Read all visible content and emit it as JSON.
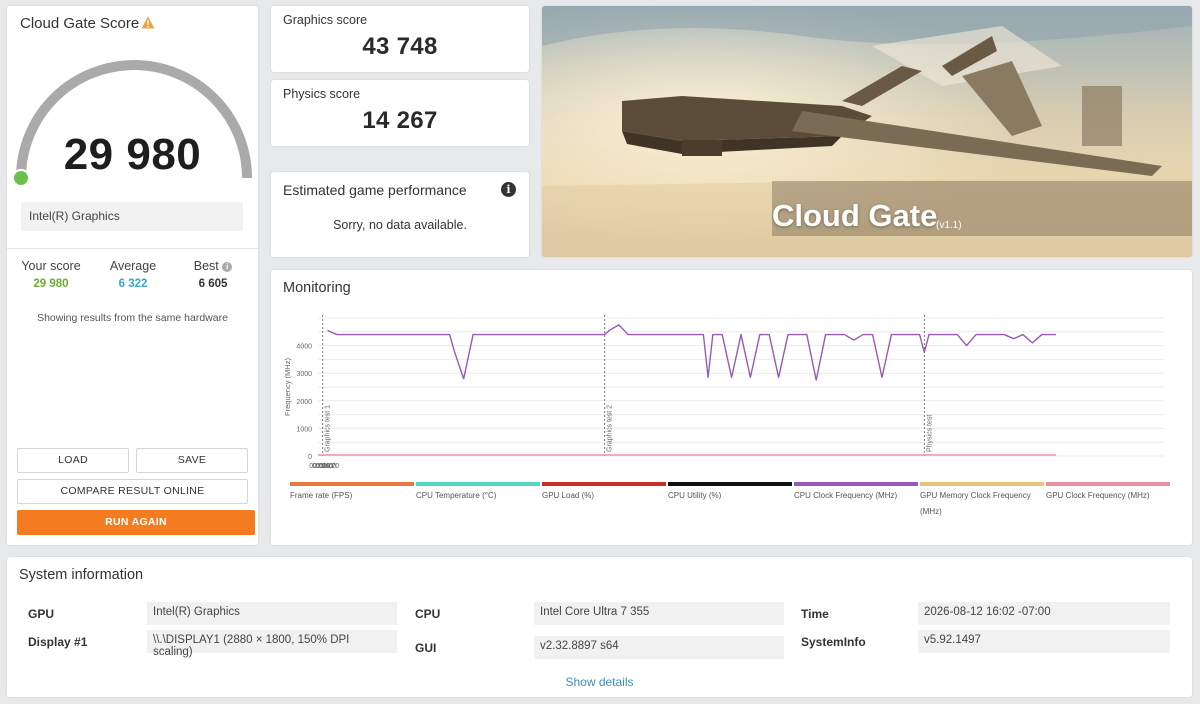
{
  "score_card": {
    "title": "Cloud Gate Score",
    "score": "29 980",
    "gpu_name": "Intel(R) Graphics",
    "stats": [
      {
        "label": "Your score",
        "value": "29 980",
        "color": "#6aaf2c"
      },
      {
        "label": "Average",
        "value": "6 322",
        "color": "#3aa5c8"
      },
      {
        "label": "Best",
        "value": "6 605",
        "color": "#333333"
      }
    ],
    "same_hardware_note": "Showing results from the same hardware",
    "buttons": {
      "load": "LOAD",
      "save": "SAVE",
      "compare": "COMPARE RESULT ONLINE",
      "run_again": "RUN AGAIN"
    },
    "accent_color": "#f47b20",
    "gauge_color": "#aaaaaa",
    "marker_color": "#6cc04a"
  },
  "graphics": {
    "label": "Graphics score",
    "value": "43 748"
  },
  "physics": {
    "label": "Physics score",
    "value": "14 267"
  },
  "estimated": {
    "title": "Estimated game performance",
    "message": "Sorry, no data available.",
    "info_icon": "info-icon"
  },
  "banner": {
    "title": "Cloud Gate",
    "version": "(v1.1)"
  },
  "monitoring": {
    "title": "Monitoring",
    "chart_data": {
      "type": "line",
      "ylabel": "Frequency (MHz)",
      "ylim": [
        0,
        5000
      ],
      "yticks": [
        "4000",
        "3000",
        "2000",
        "1000",
        "0"
      ],
      "xticks": [
        "00:00",
        "00:20",
        "00:40",
        "01:00",
        "01:20"
      ],
      "xlim": [
        0,
        90
      ],
      "grid": true,
      "markers": [
        {
          "label": "Graphics test 1",
          "x": 0.5
        },
        {
          "label": "Graphics test 2",
          "x": 30.5
        },
        {
          "label": "Physics test",
          "x": 64.5
        }
      ],
      "series": [
        {
          "name": "CPU Clock Frequency (MHz)",
          "color": "#9b59b6",
          "x": [
            1,
            2,
            14,
            14.5,
            15.5,
            16.5,
            30.5,
            31,
            32,
            33,
            34,
            35,
            40,
            41,
            41.5,
            42,
            43,
            44,
            45,
            46,
            47,
            48,
            49,
            50,
            51,
            52,
            53,
            54,
            55,
            56,
            57,
            58,
            59,
            60,
            61,
            62,
            63,
            64,
            64.5,
            65,
            66,
            68,
            69,
            70,
            71,
            72,
            73,
            74,
            75,
            76,
            77,
            78,
            78.5
          ],
          "y": [
            4550,
            4400,
            4400,
            3800,
            2800,
            4400,
            4400,
            4550,
            4750,
            4400,
            4400,
            4400,
            4400,
            4400,
            2850,
            4400,
            4400,
            2850,
            4400,
            2850,
            4400,
            4400,
            2850,
            4400,
            4400,
            4400,
            2750,
            4400,
            4400,
            4400,
            4200,
            4400,
            4400,
            2850,
            4400,
            4400,
            4400,
            4400,
            3750,
            4400,
            4400,
            4400,
            4000,
            4400,
            4400,
            4400,
            4400,
            4250,
            4400,
            4100,
            4400,
            4400,
            4400
          ]
        },
        {
          "name": "GPU Clock Frequency (MHz)",
          "color": "#e88fa2",
          "x": [
            0,
            78.5
          ],
          "y": [
            40,
            40
          ]
        }
      ]
    },
    "legend": [
      {
        "name": "Frame rate (FPS)",
        "color": "#e8793a"
      },
      {
        "name": "CPU Temperature (°C)",
        "color": "#4fd8c4"
      },
      {
        "name": "GPU Load (%)",
        "color": "#c9302c"
      },
      {
        "name": "CPU Utility (%)",
        "color": "#111111"
      },
      {
        "name": "CPU Clock Frequency (MHz)",
        "color": "#9b59b6"
      },
      {
        "name": "GPU Memory Clock Frequency (MHz)",
        "color": "#e8c37a"
      },
      {
        "name": "GPU Clock Frequency (MHz)",
        "color": "#e88fa2"
      }
    ]
  },
  "system_info": {
    "title": "System information",
    "rows": [
      {
        "label": "GPU",
        "value": "Intel(R) Graphics"
      },
      {
        "label": "Display #1",
        "value": "\\\\.\\DISPLAY1 (2880 × 1800, 150% DPI scaling)"
      },
      {
        "label": "CPU",
        "value": "Intel Core Ultra 7 355"
      },
      {
        "label": "GUI",
        "value": "v2.32.8897 s64"
      },
      {
        "label": "Time",
        "value": "2026-08-12 16:02 -07:00"
      },
      {
        "label": "SystemInfo",
        "value": "v5.92.1497"
      }
    ],
    "show_details": "Show details",
    "link_color": "#3a8fb7"
  }
}
